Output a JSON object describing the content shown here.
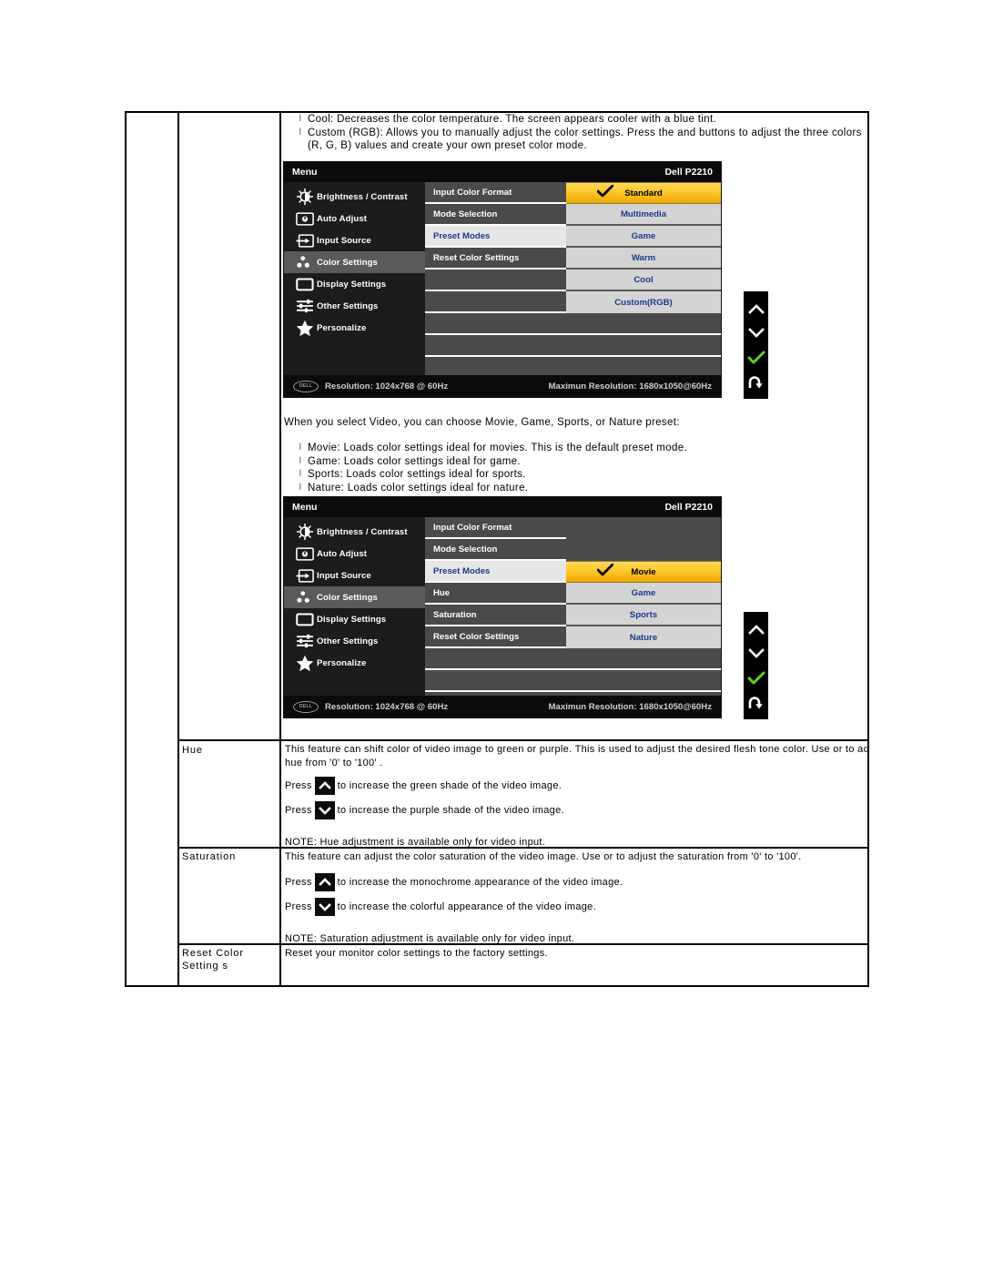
{
  "document": {
    "intro_bullets": [
      "Cool: Decreases the color temperature. The screen appears cooler with a blue tint.",
      "Custom (RGB): Allows you to manually adjust the color settings. Press the and buttons to adjust the three colors (R, G, B) values and create your own preset color mode."
    ],
    "video_intro": "When you select Video, you can choose Movie, Game, Sports, or Nature preset:",
    "video_bullets": [
      "Movie: Loads color settings ideal for movies. This is the default preset mode.",
      "Game: Loads color settings ideal for game.",
      "Sports: Loads color settings ideal for sports.",
      "Nature: Loads color settings ideal for nature."
    ],
    "bullet_marker": "l"
  },
  "osd_common": {
    "menu_label": "Menu",
    "model": "Dell P2210",
    "sidebar": [
      {
        "label": "Brightness / Contrast",
        "icon": "brightness-icon"
      },
      {
        "label": "Auto Adjust",
        "icon": "auto-adjust-icon"
      },
      {
        "label": "Input Source",
        "icon": "input-source-icon"
      },
      {
        "label": "Color Settings",
        "icon": "color-settings-icon"
      },
      {
        "label": "Display Settings",
        "icon": "display-settings-icon"
      },
      {
        "label": "Other Settings",
        "icon": "other-settings-icon"
      },
      {
        "label": "Personalize",
        "icon": "personalize-star-icon"
      }
    ],
    "active_sidebar_index": 3,
    "footer": {
      "logo_text": "DELL",
      "resolution": "Resolution: 1024x768 @ 60Hz",
      "max_resolution": "Maximun Resolution: 1680x1050@60Hz"
    },
    "nav_buttons": [
      {
        "name": "nav-up",
        "glyph": "chevron-up"
      },
      {
        "name": "nav-down",
        "glyph": "chevron-down"
      },
      {
        "name": "nav-ok",
        "glyph": "check"
      },
      {
        "name": "nav-back",
        "glyph": "back-arrow"
      }
    ],
    "accent_highlight": "#f0a800",
    "submenu_text_color": "#1b3a8c"
  },
  "osd_pc": {
    "middle_items": [
      {
        "label": "Input Color Format",
        "selected": false
      },
      {
        "label": "Mode Selection",
        "selected": false
      },
      {
        "label": "Preset Modes",
        "selected": true
      },
      {
        "label": "Reset Color Settings",
        "selected": false
      }
    ],
    "submenu": {
      "items": [
        {
          "label": "Standard",
          "checked": true
        },
        {
          "label": "Multimedia",
          "checked": false
        },
        {
          "label": "Game",
          "checked": false
        },
        {
          "label": "Warm",
          "checked": false
        },
        {
          "label": "Cool",
          "checked": false
        },
        {
          "label": "Custom(RGB)",
          "checked": false
        }
      ]
    }
  },
  "osd_video": {
    "middle_items": [
      {
        "label": "Input Color Format",
        "selected": false
      },
      {
        "label": "Mode Selection",
        "selected": false
      },
      {
        "label": "Preset Modes",
        "selected": true
      },
      {
        "label": "Hue",
        "selected": false
      },
      {
        "label": "Saturation",
        "selected": false
      },
      {
        "label": "Reset Color Settings",
        "selected": false
      }
    ],
    "submenu": {
      "items": [
        {
          "label": "Movie",
          "checked": true
        },
        {
          "label": "Game",
          "checked": false
        },
        {
          "label": "Sports",
          "checked": false
        },
        {
          "label": "Nature",
          "checked": false
        }
      ]
    }
  },
  "table": {
    "rows": [
      {
        "name": "Hue",
        "desc": "This feature can shift color of video image to green or purple. This is used to adjust the desired flesh tone color. Use or to adjust the",
        "desc2": "hue from '0' to '100' .",
        "press_up": "to increase the green shade of the video image.",
        "press_down": "to increase the purple shade of the video image.",
        "note": "NOTE: Hue adjustment is available only for video input.",
        "press_word": "Press"
      },
      {
        "name": "Saturation",
        "desc": "This feature can adjust the color saturation of the video image. Use or to adjust the saturation from '0' to '100'.",
        "desc2": "",
        "press_up": "to increase the monochrome appearance of the video image.",
        "press_down": "to increase the colorful appearance of the video image.",
        "note": "NOTE: Saturation adjustment is available only for video input.",
        "press_word": "Press"
      },
      {
        "name": "Reset Color Setting s",
        "desc": "Reset your monitor color settings to the factory settings.",
        "desc2": "",
        "press_up": "",
        "press_down": "",
        "note": "",
        "press_word": ""
      }
    ]
  }
}
